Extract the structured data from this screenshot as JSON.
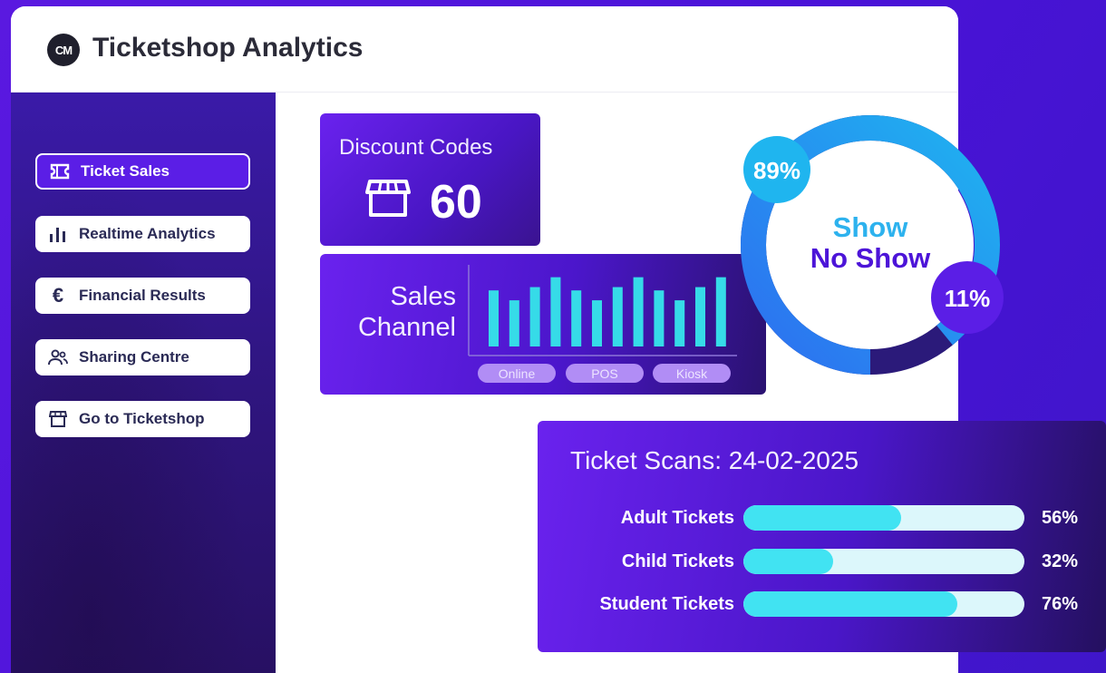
{
  "app": {
    "logo_text": "CM",
    "title": "Ticketshop Analytics"
  },
  "sidebar": {
    "items": [
      {
        "label": "Ticket Sales",
        "icon": "ticket-icon",
        "active": true
      },
      {
        "label": "Realtime Analytics",
        "icon": "bar-chart-icon",
        "active": false
      },
      {
        "label": "Financial Results",
        "icon": "euro-icon",
        "active": false
      },
      {
        "label": "Sharing Centre",
        "icon": "users-icon",
        "active": false
      },
      {
        "label": "Go to Ticketshop",
        "icon": "store-icon",
        "active": false
      }
    ]
  },
  "discount": {
    "title": "Discount Codes",
    "value": "60",
    "icon": "store-icon"
  },
  "sales_channel": {
    "title_line1": "Sales",
    "title_line2": "Channel",
    "legend": [
      "Online",
      "POS",
      "Kiosk"
    ]
  },
  "show_no_show": {
    "line1": "Show",
    "line2": "No Show",
    "show_pct": "89%",
    "no_show_pct": "11%"
  },
  "scans": {
    "title": "Ticket Scans: 24-02-2025",
    "rows": [
      {
        "label": "Adult Tickets",
        "pct": "56%",
        "value": 56
      },
      {
        "label": "Child Tickets",
        "pct": "32%",
        "value": 32
      },
      {
        "label": "Student Tickets",
        "pct": "76%",
        "value": 76
      }
    ]
  },
  "chart_data": [
    {
      "type": "bar",
      "title": "Sales Channel",
      "categories": [
        "Online",
        "POS",
        "Kiosk"
      ],
      "values": [
        8.5,
        7,
        9,
        10.5,
        8.5,
        7,
        9,
        10.5,
        8.5,
        7,
        9,
        10.5
      ],
      "bar_color": "#36dbe8"
    },
    {
      "type": "pie",
      "labels": [
        "Show",
        "No Show"
      ],
      "values": [
        89,
        11
      ],
      "colors": [
        "#2aa6f0",
        "#2b1a7a"
      ]
    },
    {
      "type": "bar",
      "title": "Ticket Scans: 24-02-2025",
      "categories": [
        "Adult Tickets",
        "Child Tickets",
        "Student Tickets"
      ],
      "values": [
        56,
        32,
        76
      ],
      "ylim": [
        0,
        100
      ],
      "orientation": "horizontal"
    }
  ],
  "colors": {
    "accent": "#5b1ee6",
    "cyan": "#41e3f2",
    "track": "#dcf7fb"
  }
}
